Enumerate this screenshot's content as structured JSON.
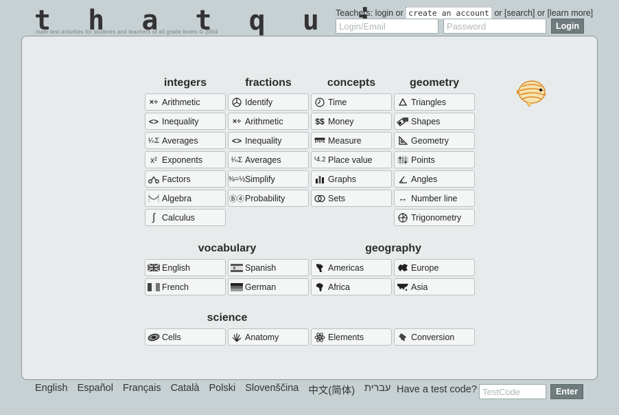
{
  "header": {
    "logo": "t h a t q u i z",
    "tagline": "math test activities for students and teachers of all grade levels © 2004",
    "teachers_prefix": "Teachers: login or",
    "create_account": "create an account",
    "or": " or ",
    "search": "[search]",
    "learn_more": "[learn more]",
    "login_placeholder": "Login/Email",
    "password_placeholder": "Password",
    "login_button": "Login"
  },
  "categories": {
    "integers": {
      "title": "integers",
      "items": [
        {
          "label": "Arithmetic",
          "icon": "arithmetic-icon"
        },
        {
          "label": "Inequality",
          "icon": "inequality-icon"
        },
        {
          "label": "Averages",
          "icon": "averages-icon"
        },
        {
          "label": "Exponents",
          "icon": "exponents-icon"
        },
        {
          "label": "Factors",
          "icon": "factors-icon"
        },
        {
          "label": "Algebra",
          "icon": "algebra-icon"
        },
        {
          "label": "Calculus",
          "icon": "integral-icon"
        }
      ]
    },
    "fractions": {
      "title": "fractions",
      "items": [
        {
          "label": "Identify",
          "icon": "pie-icon"
        },
        {
          "label": "Arithmetic",
          "icon": "arithmetic-icon"
        },
        {
          "label": "Inequality",
          "icon": "inequality-icon"
        },
        {
          "label": "Averages",
          "icon": "averages-icon"
        },
        {
          "label": "Simplify",
          "icon": "simplify-icon"
        },
        {
          "label": "Probability",
          "icon": "probability-icon"
        }
      ]
    },
    "concepts": {
      "title": "concepts",
      "items": [
        {
          "label": "Time",
          "icon": "clock-icon"
        },
        {
          "label": "Money",
          "icon": "money-icon"
        },
        {
          "label": "Measure",
          "icon": "ruler-icon"
        },
        {
          "label": "Place value",
          "icon": "place-value-icon"
        },
        {
          "label": "Graphs",
          "icon": "bar-graph-icon"
        },
        {
          "label": "Sets",
          "icon": "venn-icon"
        }
      ]
    },
    "geometry": {
      "title": "geometry",
      "items": [
        {
          "label": "Triangles",
          "icon": "triangle-icon"
        },
        {
          "label": "Shapes",
          "icon": "shapes-icon"
        },
        {
          "label": "Geometry",
          "icon": "set-square-icon"
        },
        {
          "label": "Points",
          "icon": "grid-points-icon"
        },
        {
          "label": "Angles",
          "icon": "angle-icon"
        },
        {
          "label": "Number line",
          "icon": "number-line-icon"
        },
        {
          "label": "Trigonometry",
          "icon": "unit-circle-icon"
        }
      ]
    },
    "vocabulary": {
      "title": "vocabulary",
      "items": [
        {
          "label": "English",
          "icon": "uk-flag-icon"
        },
        {
          "label": "Spanish",
          "icon": "spain-flag-icon"
        },
        {
          "label": "French",
          "icon": "france-flag-icon"
        },
        {
          "label": "German",
          "icon": "germany-flag-icon"
        }
      ]
    },
    "geography": {
      "title": "geography",
      "items": [
        {
          "label": "Americas",
          "icon": "americas-map-icon"
        },
        {
          "label": "Europe",
          "icon": "europe-map-icon"
        },
        {
          "label": "Africa",
          "icon": "africa-map-icon"
        },
        {
          "label": "Asia",
          "icon": "asia-map-icon"
        }
      ]
    },
    "science": {
      "title": "science",
      "items": [
        {
          "label": "Cells",
          "icon": "cell-icon"
        },
        {
          "label": "Anatomy",
          "icon": "hand-skeleton-icon"
        },
        {
          "label": "Elements",
          "icon": "atom-icon"
        },
        {
          "label": "Conversion",
          "icon": "conversion-icon"
        }
      ]
    }
  },
  "mascot": {
    "icon": "butterflyfish-icon"
  },
  "footer": {
    "languages": [
      "English",
      "Español",
      "Français",
      "Català",
      "Polski",
      "Slovenščina",
      "中文(简体)",
      "עברית"
    ],
    "test_code_label": "Have a test code?",
    "test_code_placeholder": "TestCode",
    "enter_button": "Enter"
  },
  "colors": {
    "page_background": "#c7d0d2",
    "panel_background": "#e8ebeb",
    "tile_background": "#f4f6f6",
    "button_grey": "#6f7b7d"
  }
}
